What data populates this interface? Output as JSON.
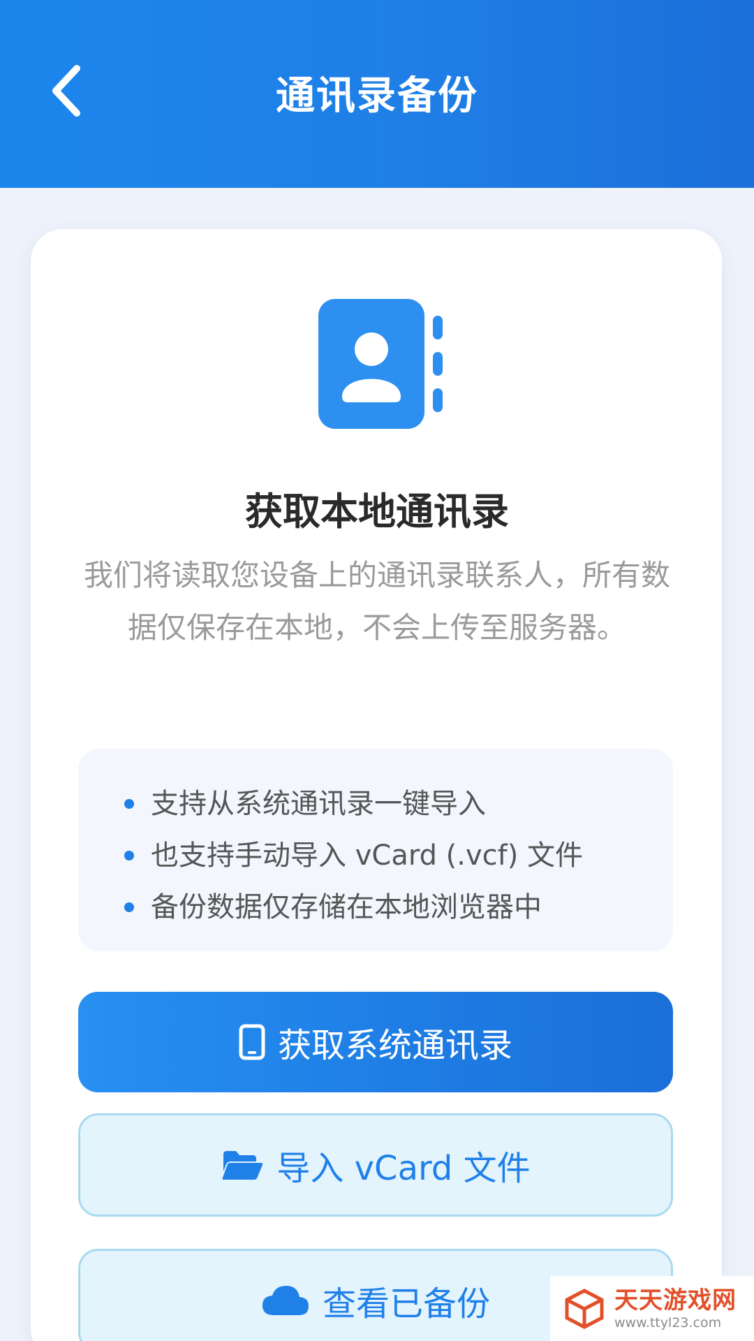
{
  "header": {
    "title": "通讯录备份",
    "back_icon": "chevron-left-icon",
    "background": "#1f7fe6"
  },
  "card": {
    "icon": "contact-book-icon",
    "title": "获取本地通讯录",
    "description": "我们将读取您设备上的通讯录联系人，所有数据仅保存在本地，不会上传至服务器。",
    "features": [
      "支持从系统通讯录一键导入",
      "也支持手动导入 vCard (.vcf) 文件",
      "备份数据仅存储在本地浏览器中"
    ]
  },
  "buttons": {
    "get_contacts": {
      "label": "获取系统通讯录",
      "icon": "phone-icon"
    },
    "import_vcard": {
      "label": "导入 vCard 文件",
      "icon": "folder-open-icon"
    },
    "view_backups": {
      "label": "查看已备份",
      "icon": "cloud-icon"
    }
  },
  "watermark": {
    "name": "天天游戏网",
    "url": "www.ttyl23.com"
  },
  "colors": {
    "accent": "#1f80e8",
    "page_background": "#eef2fb",
    "watermark": "#e2502a"
  }
}
